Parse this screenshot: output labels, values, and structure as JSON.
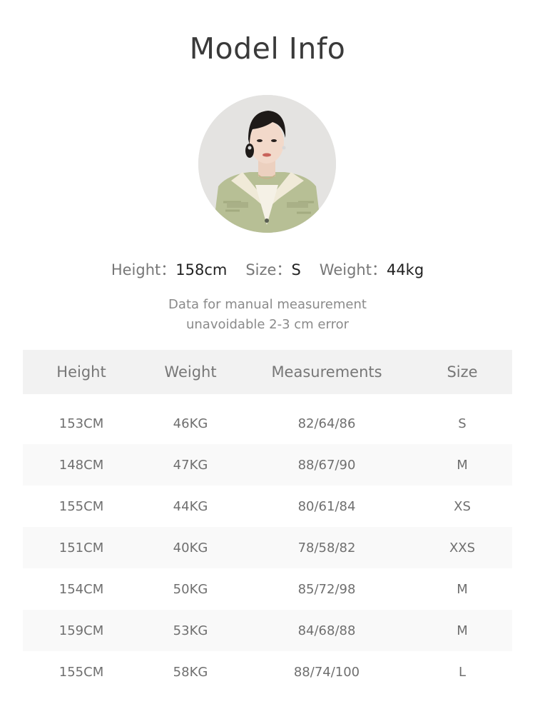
{
  "title": "Model Info",
  "model": {
    "height_label": "Height：",
    "height_value": "158cm",
    "size_label": "Size：",
    "size_value": "S",
    "weight_label": "Weight：",
    "weight_value": "44kg"
  },
  "note": {
    "line1": "Data for manual measurement",
    "line2": "unavoidable 2-3 cm error"
  },
  "table": {
    "headers": [
      "Height",
      "Weight",
      "Measurements",
      "Size"
    ],
    "rows": [
      [
        "153CM",
        "46KG",
        "82/64/86",
        "S"
      ],
      [
        "148CM",
        "47KG",
        "88/67/90",
        "M"
      ],
      [
        "155CM",
        "44KG",
        "80/61/84",
        "XS"
      ],
      [
        "151CM",
        "40KG",
        "78/58/82",
        "XXS"
      ],
      [
        "154CM",
        "50KG",
        "85/72/98",
        "M"
      ],
      [
        "159CM",
        "53KG",
        "84/68/88",
        "M"
      ],
      [
        "155CM",
        "58KG",
        "88/74/100",
        "L"
      ]
    ]
  },
  "colors": {
    "header_bg": "#f2f2f2",
    "shaded_row_bg": "#f9f9f9",
    "title": "#3a3a3a",
    "jacket": "#b6bf94"
  }
}
